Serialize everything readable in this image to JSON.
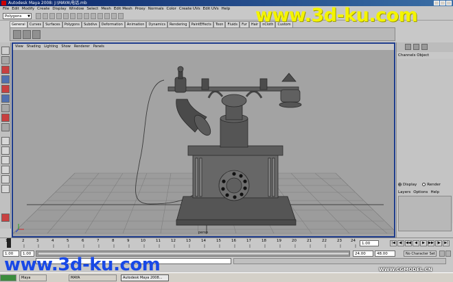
{
  "window": {
    "title": "Autodesk Maya 2008: J:\\MAYA\\电话.mb"
  },
  "menubar": {
    "items": [
      "File",
      "Edit",
      "Modify",
      "Create",
      "Display",
      "Window",
      "Select",
      "Mesh",
      "Edit Mesh",
      "Proxy",
      "Normals",
      "Color",
      "Create UVs",
      "Edit UVs",
      "Help"
    ]
  },
  "statusline": {
    "mode": "Polygons"
  },
  "shelf": {
    "tabs": [
      "General",
      "Curves",
      "Surfaces",
      "Polygons",
      "Subdivs",
      "Deformation",
      "Animation",
      "Dynamics",
      "Rendering",
      "PaintEffects",
      "Toon",
      "Fluids",
      "Fur",
      "Hair",
      "nCloth",
      "Custom"
    ],
    "active_tab": "General"
  },
  "viewport": {
    "panel_menu": [
      "View",
      "Shading",
      "Lighting",
      "Show",
      "Renderer",
      "Panels"
    ],
    "camera": "persp"
  },
  "channel_box": {
    "header": "Channels  Object",
    "layer_modes": [
      "Display",
      "Render"
    ],
    "layer_menu": [
      "Layers",
      "Options",
      "Help"
    ]
  },
  "time_slider": {
    "ticks": [
      "1",
      "2",
      "3",
      "4",
      "5",
      "6",
      "7",
      "8",
      "9",
      "10",
      "11",
      "12",
      "13",
      "14",
      "15",
      "16",
      "17",
      "18",
      "19",
      "20",
      "21",
      "22",
      "23",
      "24"
    ],
    "current_frame": "1.00",
    "playback_buttons": [
      "|◀",
      "◀|",
      "◀◀",
      "◀",
      "▶",
      "▶▶",
      "|▶",
      "▶|"
    ]
  },
  "range_slider": {
    "start_time": "1.00",
    "playback_start": "1.00",
    "playback_end": "24.00",
    "end_time": "48.00",
    "character_set": "No Character Set"
  },
  "taskbar": {
    "items": [
      "",
      "Maya",
      "MAYA",
      "Autodesk Maya 2008..."
    ]
  },
  "watermarks": {
    "top": "www.3d-ku.com",
    "bottom": "www.3d-ku.com",
    "corner": "WWW.CGMODEL.CN"
  }
}
